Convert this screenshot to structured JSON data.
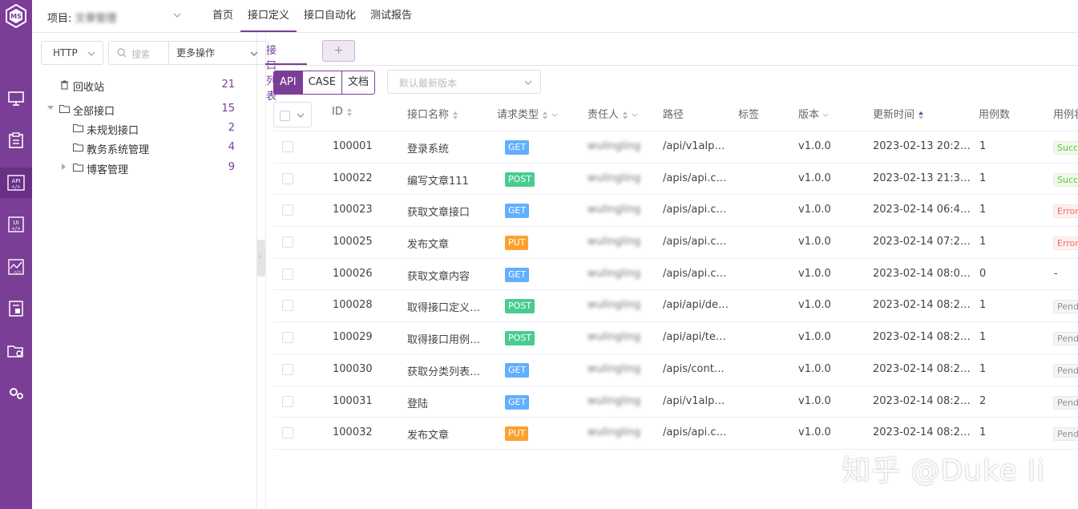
{
  "rail": {
    "logo_text": "MS",
    "items": [
      {
        "icon": "monitor-icon"
      },
      {
        "icon": "clipboard-icon"
      },
      {
        "icon": "api-icon",
        "text": "API",
        "active": true
      },
      {
        "icon": "ui-icon",
        "text": "UI"
      },
      {
        "icon": "performance-chart-icon"
      },
      {
        "icon": "report-icon"
      },
      {
        "icon": "folder-settings-icon"
      },
      {
        "icon": "gears-icon"
      }
    ]
  },
  "header": {
    "project_label": "项目:",
    "project_name": "文章管理",
    "tabs": [
      {
        "label": "首页"
      },
      {
        "label": "接口定义",
        "active": true
      },
      {
        "label": "接口自动化"
      },
      {
        "label": "测试报告"
      }
    ]
  },
  "tree": {
    "protocol": "HTTP",
    "search_placeholder": "搜索",
    "more_actions": "更多操作",
    "nodes": [
      {
        "label": "回收站",
        "count": "21"
      },
      {
        "label": "全部接口",
        "count": "15"
      },
      {
        "label": "未规划接口",
        "count": "2"
      },
      {
        "label": "教务系统管理",
        "count": "4"
      },
      {
        "label": "博客管理",
        "count": "9"
      }
    ]
  },
  "main": {
    "tab_label": "接口列表",
    "add_tab": "+",
    "mode_options": [
      "API",
      "CASE",
      "文档"
    ],
    "version_placeholder": "默认最新版本"
  },
  "table": {
    "columns": [
      "ID",
      "接口名称",
      "请求类型",
      "责任人",
      "路径",
      "标签",
      "版本",
      "更新时间",
      "用例数",
      "用例状态"
    ],
    "rows": [
      {
        "id": "100001",
        "name": "登录系统",
        "method": "GET",
        "owner": "wulingling",
        "path": "/api/v1alp…",
        "version": "v1.0.0",
        "updated": "2023-02-13 20:2…",
        "cases": "1",
        "status": "Success",
        "status_type": "success"
      },
      {
        "id": "100022",
        "name": "编写文章111",
        "method": "POST",
        "owner": "wulingling",
        "path": "/apis/api.c…",
        "version": "v1.0.0",
        "updated": "2023-02-13 21:3…",
        "cases": "1",
        "status": "Success",
        "status_type": "success"
      },
      {
        "id": "100023",
        "name": "获取文章接口",
        "method": "GET",
        "owner": "wulingling",
        "path": "/apis/api.c…",
        "version": "v1.0.0",
        "updated": "2023-02-14 06:4…",
        "cases": "1",
        "status": "Error",
        "status_type": "error"
      },
      {
        "id": "100025",
        "name": "发布文章",
        "method": "PUT",
        "owner": "wulingling",
        "path": "/apis/api.c…",
        "version": "v1.0.0",
        "updated": "2023-02-14 07:2…",
        "cases": "1",
        "status": "Error",
        "status_type": "error"
      },
      {
        "id": "100026",
        "name": "获取文章内容",
        "method": "GET",
        "owner": "wulingling",
        "path": "/apis/api.c…",
        "version": "v1.0.0",
        "updated": "2023-02-14 08:0…",
        "cases": "0",
        "status": "-",
        "status_type": "none"
      },
      {
        "id": "100028",
        "name": "取得接口定义…",
        "method": "POST",
        "owner": "wulingling",
        "path": "/api/api/de…",
        "version": "v1.0.0",
        "updated": "2023-02-14 08:2…",
        "cases": "1",
        "status": "Pending",
        "status_type": "pending"
      },
      {
        "id": "100029",
        "name": "取得接口用例…",
        "method": "POST",
        "owner": "wulingling",
        "path": "/api/api/te…",
        "version": "v1.0.0",
        "updated": "2023-02-14 08:2…",
        "cases": "1",
        "status": "Pending",
        "status_type": "pending"
      },
      {
        "id": "100030",
        "name": "获取分类列表…",
        "method": "GET",
        "owner": "wulingling",
        "path": "/apis/cont…",
        "version": "v1.0.0",
        "updated": "2023-02-14 08:2…",
        "cases": "1",
        "status": "Pending",
        "status_type": "pending"
      },
      {
        "id": "100031",
        "name": "登陆",
        "method": "GET",
        "owner": "wulingling",
        "path": "/api/v1alp…",
        "version": "v1.0.0",
        "updated": "2023-02-14 08:2…",
        "cases": "2",
        "status": "Pending",
        "status_type": "pending"
      },
      {
        "id": "100032",
        "name": "发布文章",
        "method": "PUT",
        "owner": "wulingling",
        "path": "/apis/api.c…",
        "version": "v1.0.0",
        "updated": "2023-02-14 08:2…",
        "cases": "1",
        "status": "Pending",
        "status_type": "pending"
      }
    ]
  },
  "watermark": "知乎 @Duke li",
  "colors": {
    "brand": "#7b3e97",
    "get": "#61affe",
    "post": "#49cc90",
    "put": "#fca130"
  }
}
